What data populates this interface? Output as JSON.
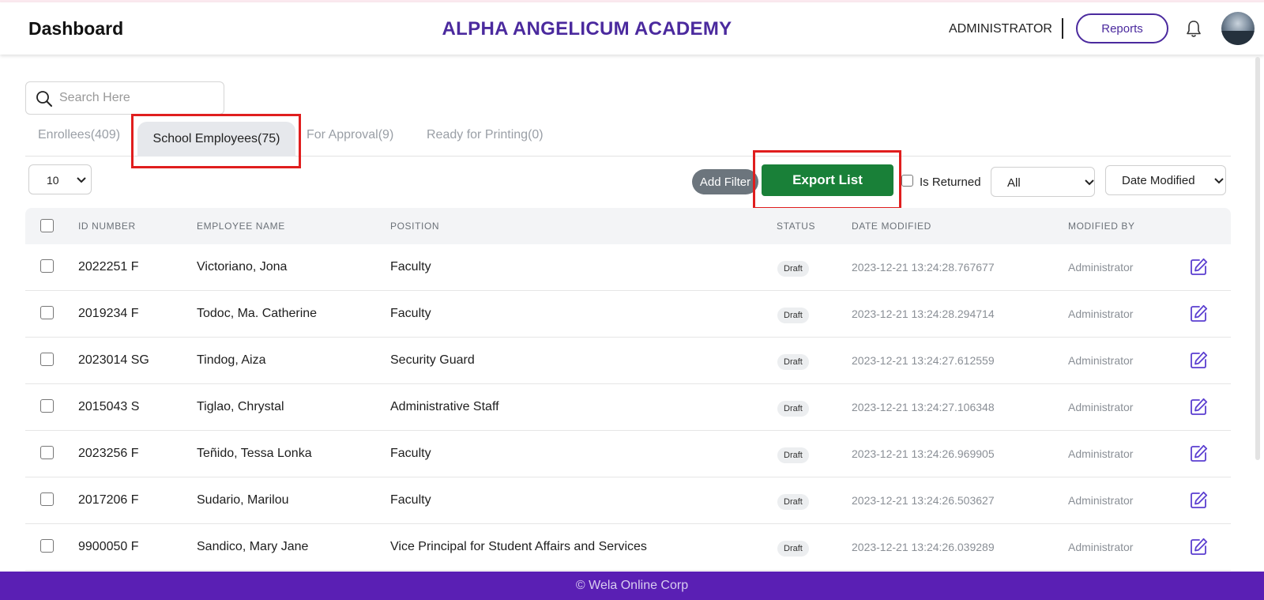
{
  "header": {
    "brand": "Dashboard",
    "school_name": "ALPHA ANGELICUM ACADEMY",
    "role": "ADMINISTRATOR",
    "reports_label": "Reports",
    "accent_color": "#4b2a9e"
  },
  "search": {
    "placeholder": "Search Here",
    "value": ""
  },
  "tabs": [
    {
      "label": "Enrollees(409)",
      "active": false
    },
    {
      "label": "School Employees(75)",
      "active": true
    },
    {
      "label": "For Approval(9)",
      "active": false
    },
    {
      "label": "Ready for Printing(0)",
      "active": false
    }
  ],
  "toolbar": {
    "page_size": "10",
    "add_filter_label": "Add Filter",
    "export_label": "Export List",
    "export_color": "#198038",
    "is_returned_label": "Is Returned",
    "is_returned_checked": false,
    "status_filter": "All",
    "sort_by": "Date Modified"
  },
  "table": {
    "headers": [
      "ID NUMBER",
      "EMPLOYEE NAME",
      "POSITION",
      "STATUS",
      "DATE MODIFIED",
      "MODIFIED BY"
    ],
    "rows": [
      {
        "id": "2022251 F",
        "name": "Victoriano, Jona",
        "position": "Faculty",
        "status": "Draft",
        "date": "2023-12-21 13:24:28.767677",
        "by": "Administrator"
      },
      {
        "id": "2019234 F",
        "name": "Todoc, Ma. Catherine",
        "position": "Faculty",
        "status": "Draft",
        "date": "2023-12-21 13:24:28.294714",
        "by": "Administrator"
      },
      {
        "id": "2023014 SG",
        "name": "Tindog, Aiza",
        "position": "Security Guard",
        "status": "Draft",
        "date": "2023-12-21 13:24:27.612559",
        "by": "Administrator"
      },
      {
        "id": "2015043 S",
        "name": "Tiglao, Chrystal",
        "position": "Administrative Staff",
        "status": "Draft",
        "date": "2023-12-21 13:24:27.106348",
        "by": "Administrator"
      },
      {
        "id": "2023256 F",
        "name": "Teñido, Tessa Lonka",
        "position": "Faculty",
        "status": "Draft",
        "date": "2023-12-21 13:24:26.969905",
        "by": "Administrator"
      },
      {
        "id": "2017206 F",
        "name": "Sudario, Marilou",
        "position": "Faculty",
        "status": "Draft",
        "date": "2023-12-21 13:24:26.503627",
        "by": "Administrator"
      },
      {
        "id": "9900050 F",
        "name": "Sandico, Mary Jane",
        "position": "Vice Principal for Student Affairs and Services",
        "status": "Draft",
        "date": "2023-12-21 13:24:26.039289",
        "by": "Administrator"
      }
    ]
  },
  "footer": {
    "text": "© Wela Online Corp",
    "color": "#5a1fb4"
  }
}
